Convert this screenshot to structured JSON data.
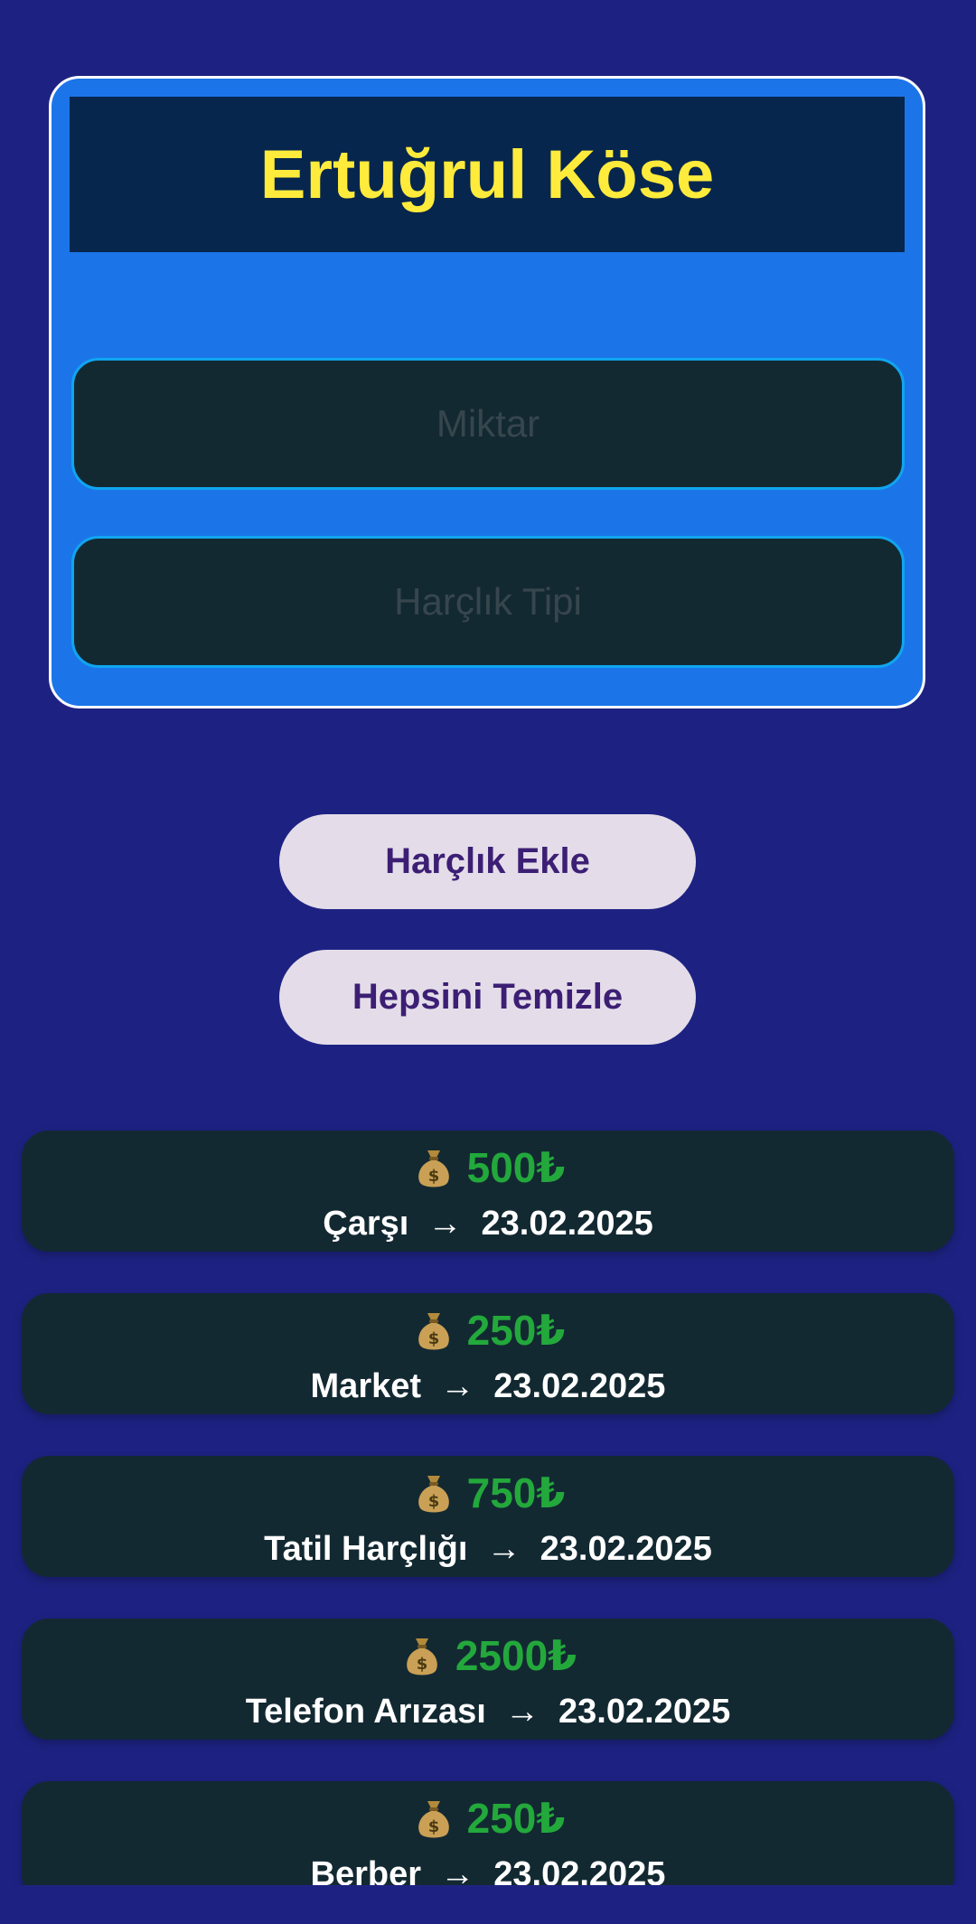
{
  "header": {
    "title": "Ertuğrul Köse"
  },
  "form": {
    "amount_placeholder": "Miktar",
    "type_placeholder": "Harçlık Tipi"
  },
  "buttons": {
    "add_label": "Harçlık Ekle",
    "clear_label": "Hepsini Temizle"
  },
  "colors": {
    "background": "#1d2282",
    "card": "#1b75e8",
    "title_bar": "#06264d",
    "title_text": "#ffeb3b",
    "amount_text": "#23a83c",
    "entry_bg": "#132932",
    "button_bg": "#e4dde9",
    "button_text": "#3c1f74"
  },
  "icons": {
    "entry_icon": "money-bag-icon",
    "arrow": "→"
  },
  "entries": [
    {
      "amount": "500₺",
      "description": "Çarşı  →  23.02.2025"
    },
    {
      "amount": "250₺",
      "description": "Market  →  23.02.2025"
    },
    {
      "amount": "750₺",
      "description": "Tatil Harçlığı  →  23.02.2025"
    },
    {
      "amount": "2500₺",
      "description": "Telefon Arızası  →  23.02.2025"
    },
    {
      "amount": "250₺",
      "description": "Berber  →  23.02.2025"
    }
  ]
}
